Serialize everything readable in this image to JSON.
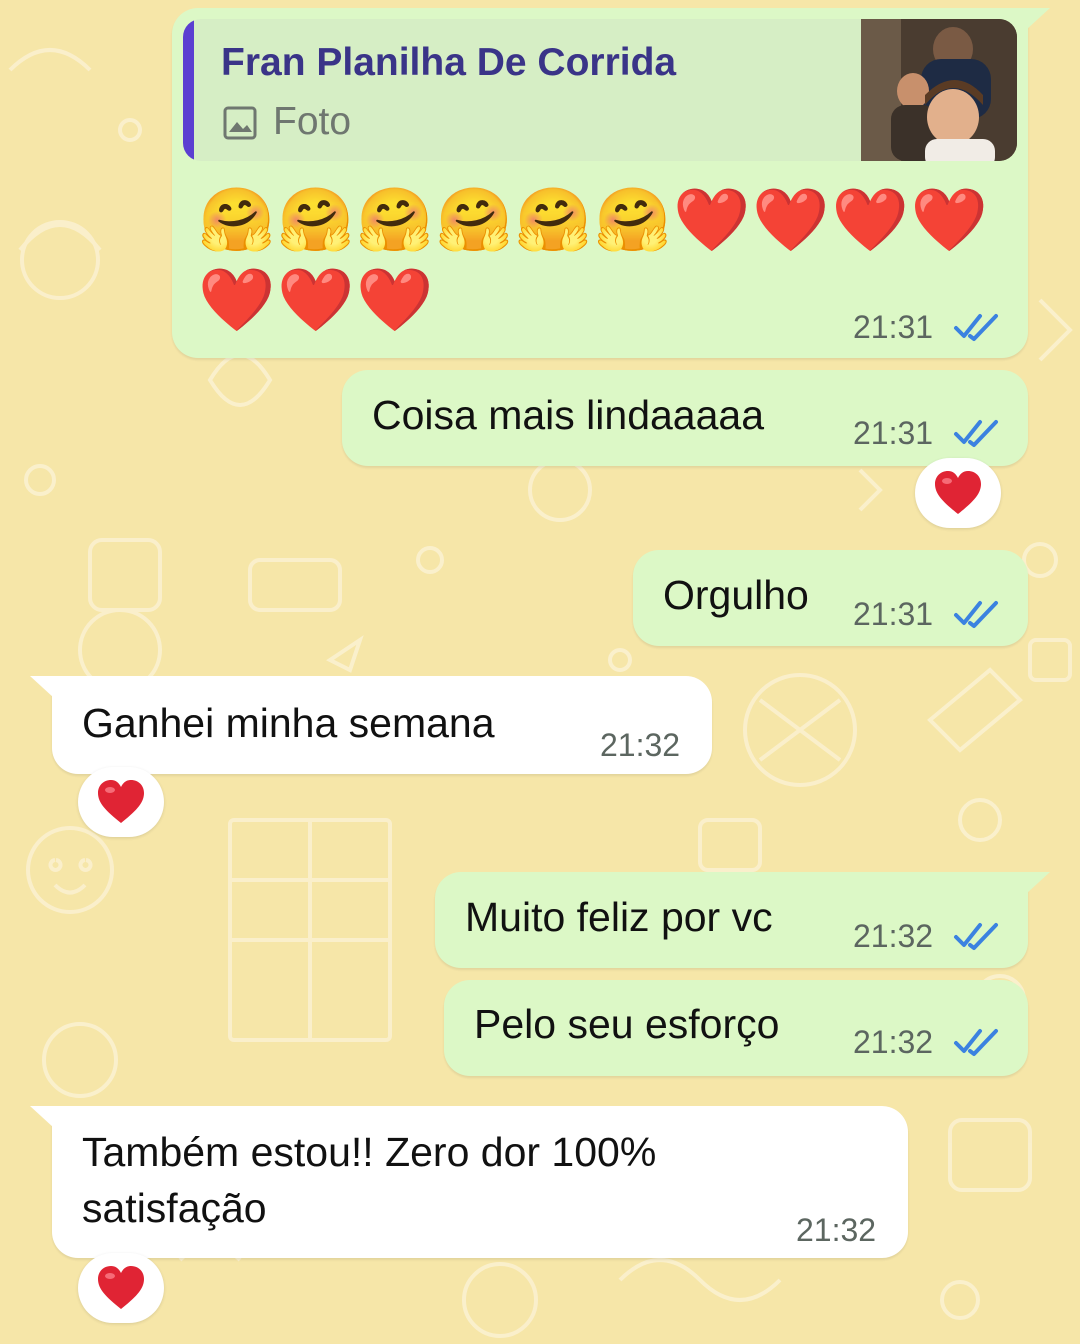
{
  "colors": {
    "wallpaper": "#f6e6a8",
    "outgoing_bubble": "#dcf8c6",
    "incoming_bubble": "#ffffff",
    "read_ticks": "#3b82e0",
    "quote_accent": "#5b3fd1"
  },
  "messages": [
    {
      "direction": "outgoing",
      "quoted": {
        "author": "Fran Planilha De Corrida",
        "type_label": "Foto",
        "type_icon": "image-icon"
      },
      "emoji_line": "🤗🤗🤗🤗🤗🤗❤️❤️❤️❤️❤️❤️❤️",
      "time": "21:31",
      "status": "read"
    },
    {
      "direction": "outgoing",
      "text": "Coisa mais lindaaaaa",
      "time": "21:31",
      "status": "read",
      "reaction": "❤️"
    },
    {
      "direction": "outgoing",
      "text": "Orgulho",
      "time": "21:31",
      "status": "read"
    },
    {
      "direction": "incoming",
      "text": "Ganhei minha semana",
      "time": "21:32",
      "reaction": "❤️"
    },
    {
      "direction": "outgoing",
      "text": "Muito feliz por vc",
      "time": "21:32",
      "status": "read"
    },
    {
      "direction": "outgoing",
      "text": "Pelo seu esforço",
      "time": "21:32",
      "status": "read"
    },
    {
      "direction": "incoming",
      "text_lines": [
        "Também estou!! Zero dor 100%",
        "satisfação"
      ],
      "time": "21:32",
      "reaction": "❤️"
    }
  ]
}
